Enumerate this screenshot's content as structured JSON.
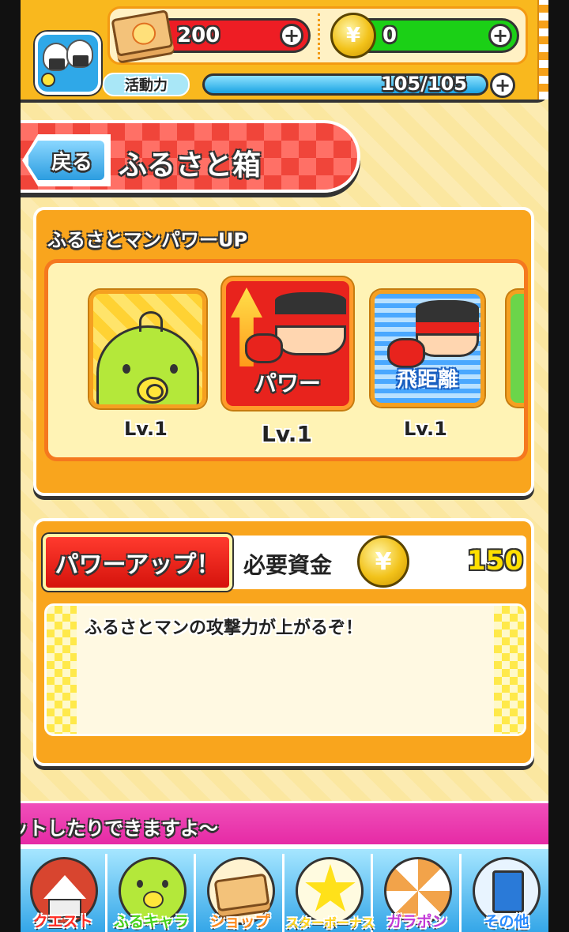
{
  "header": {
    "tickets": "200",
    "coins": "0",
    "stamina_label": "活動力",
    "stamina_text": "105/105",
    "stamina_fraction": 1.0,
    "plus_symbol": "+",
    "yen_symbol": "¥",
    "icons": {
      "avatar": "onigiri-avatar",
      "ticket": "ticket-stack-icon",
      "coin": "yen-coin-icon",
      "plus": "plus-icon"
    }
  },
  "banner": {
    "back_label": "戻る",
    "title": "ふるさと箱"
  },
  "powerup": {
    "heading": "ふるさとマンパワーUP",
    "items": [
      {
        "level": "Lv.1",
        "icon": "chick-pacifier-icon"
      },
      {
        "level": "Lv.1",
        "caption": "パワー",
        "icon": "power-up-hero-icon"
      },
      {
        "level": "Lv.1",
        "caption": "飛距離",
        "icon": "distance-hero-icon"
      },
      {
        "icon": "partial-green-item-icon"
      }
    ]
  },
  "detail": {
    "button_label": "パワーアップ！",
    "cost_label": "必要資金",
    "cost_value": "150",
    "description": "ふるさとマンの攻撃力が上がるぞ！"
  },
  "ticker": {
    "text": "ットしたりできますよ～"
  },
  "nav": {
    "items": [
      {
        "label": "クエスト",
        "icon": "tent-icon"
      },
      {
        "label": "ふるキャラ",
        "icon": "chick-icon"
      },
      {
        "label": "ショップ",
        "icon": "ticket-stack-icon"
      },
      {
        "label": "スターボーナス",
        "icon": "star-icon"
      },
      {
        "label": "ガラポン",
        "icon": "lottery-wheel-icon"
      },
      {
        "label": "その他",
        "icon": "book-icon"
      }
    ]
  },
  "colors": {
    "accent_orange": "#f9a51d",
    "banner_red": "#f0453a",
    "ticket_red": "#ee1d24",
    "coin_green": "#1bd016",
    "stamina_blue": "#1aa3e3",
    "ticker_pink": "#e62aa5"
  }
}
